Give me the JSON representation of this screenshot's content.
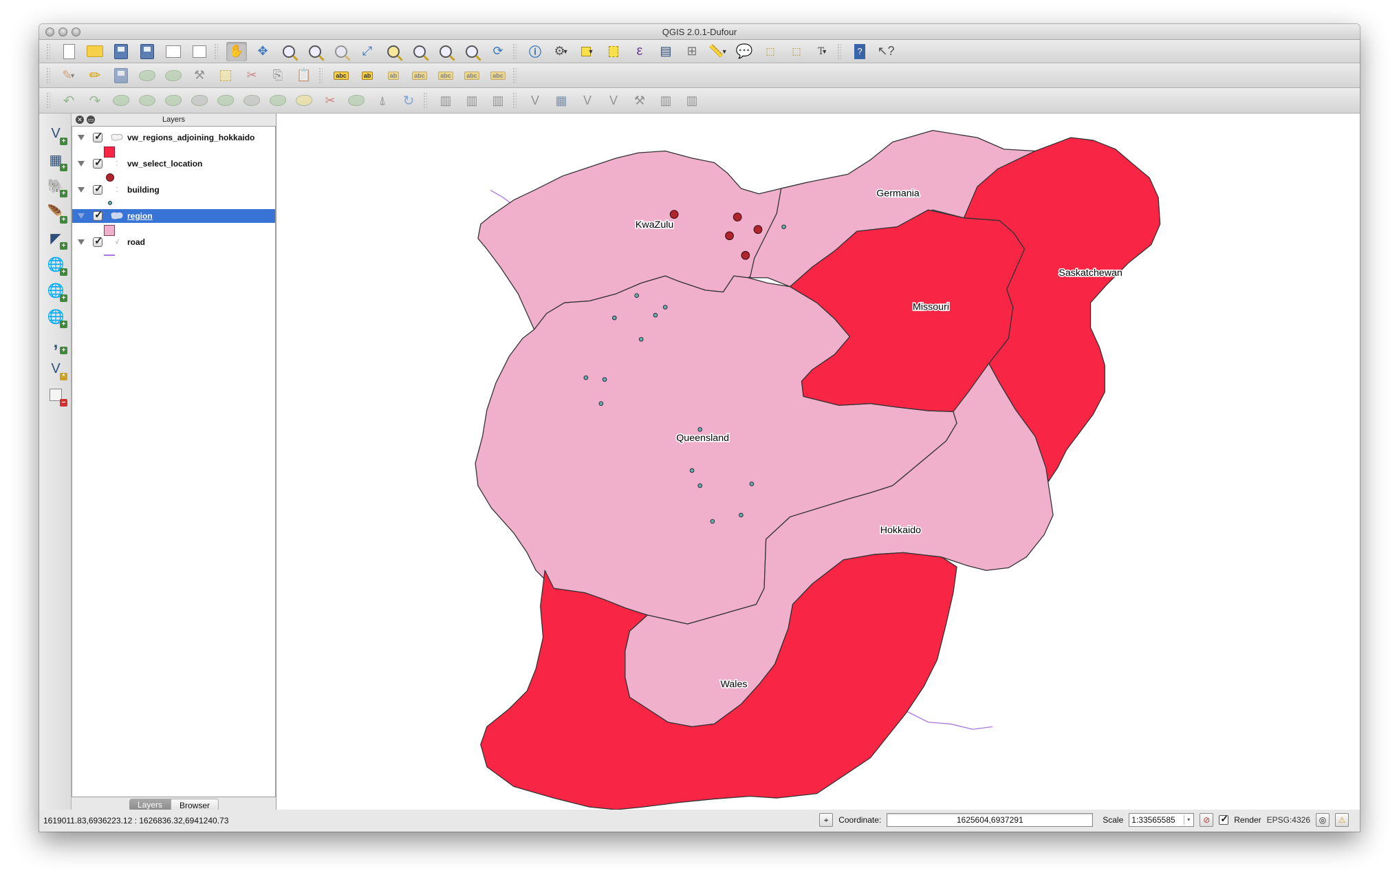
{
  "window": {
    "title": "QGIS 2.0.1-Dufour"
  },
  "toolbars": {
    "file": [
      "new-project",
      "open-project",
      "save-project",
      "save-project-as",
      "new-print-composer",
      "composer-manager"
    ],
    "navigation": [
      "pan",
      "pan-to-selection",
      "zoom-in",
      "zoom-out",
      "zoom-actual-size",
      "zoom-full",
      "zoom-to-selection",
      "zoom-to-layer",
      "zoom-last",
      "refresh"
    ],
    "attributes": [
      "identify",
      "run-action",
      "select-features",
      "deselect-all",
      "expression-select",
      "open-attribute-table",
      "field-calculator",
      "measure",
      "map-tips",
      "new-bookmark",
      "show-bookmarks",
      "text-annotation",
      "help-contents",
      "whats-this"
    ],
    "digitizing": [
      "current-edits",
      "toggle-editing",
      "save-layer-edits",
      "add-feature",
      "move-feature",
      "node-tool",
      "delete-selected",
      "cut-features",
      "copy-features",
      "paste-features"
    ],
    "labels": [
      "layer-labeling",
      "pin-labels",
      "show-hide-labels",
      "move-label",
      "rotate-label",
      "change-label"
    ],
    "advanced_digitizing": [
      "undo",
      "redo",
      "simplify-feature",
      "add-ring",
      "add-part",
      "fill-ring",
      "delete-ring",
      "delete-part",
      "reshape-features",
      "offset-curve",
      "split-features",
      "split-parts",
      "merge-selected",
      "rotate-point-symbols"
    ],
    "plugins": [
      "gps-import",
      "gps-add-layer",
      "gps-remove-layer",
      "add-wfs",
      "add-wms",
      "add-wcs-raster",
      "osm-edit",
      "georeferencer",
      "georeferencer-edit"
    ]
  },
  "left_toolbar": [
    "add-vector-layer",
    "add-raster-layer",
    "add-postgis-layer",
    "add-spatialite-layer",
    "add-mssql-layer",
    "add-wms-layer",
    "add-wcs-layer",
    "add-wfs-layer",
    "add-delimited-text-layer",
    "new-shapefile-layer",
    "remove-layer"
  ],
  "layers_panel": {
    "title": "Layers",
    "layers": [
      {
        "name": "vw_regions_adjoining_hokkaido",
        "checked": true,
        "type": "polygon",
        "legend": "fill",
        "color": "#f92544",
        "selected": false
      },
      {
        "name": "vw_select_location",
        "checked": true,
        "type": "point",
        "legend": "circle",
        "color": "#b0242e",
        "selected": false
      },
      {
        "name": "building",
        "checked": true,
        "type": "point",
        "legend": "small-circle",
        "color": "#5fb0aa",
        "selected": false
      },
      {
        "name": "region",
        "checked": true,
        "type": "polygon",
        "legend": "fill",
        "color": "#f0b0cc",
        "selected": true
      },
      {
        "name": "road",
        "checked": true,
        "type": "line",
        "legend": "line",
        "color": "#a878e0",
        "selected": false
      }
    ],
    "tabs": [
      {
        "label": "Layers",
        "active": true
      },
      {
        "label": "Browser",
        "active": false
      }
    ]
  },
  "map": {
    "colors": {
      "adjoining": "#f92544",
      "region": "#f0b0cc",
      "outline": "#333333",
      "select_point": "#b0242e",
      "building": "#5fb0aa",
      "road": "#a878e0"
    },
    "labels": [
      "KwaZulu",
      "Germania",
      "Saskatchewan",
      "Missouri",
      "Queensland",
      "Hokkaido",
      "Wales"
    ]
  },
  "statusbar": {
    "extent": "1619011.83,6936223.12 : 1626836.32,6941240.73",
    "coordinate_label": "Coordinate:",
    "coordinate_value": "1625604,6937291",
    "scale_label": "Scale",
    "scale_value": "1:33565585",
    "render_label": "Render",
    "render_checked": true,
    "crs": "EPSG:4326"
  }
}
